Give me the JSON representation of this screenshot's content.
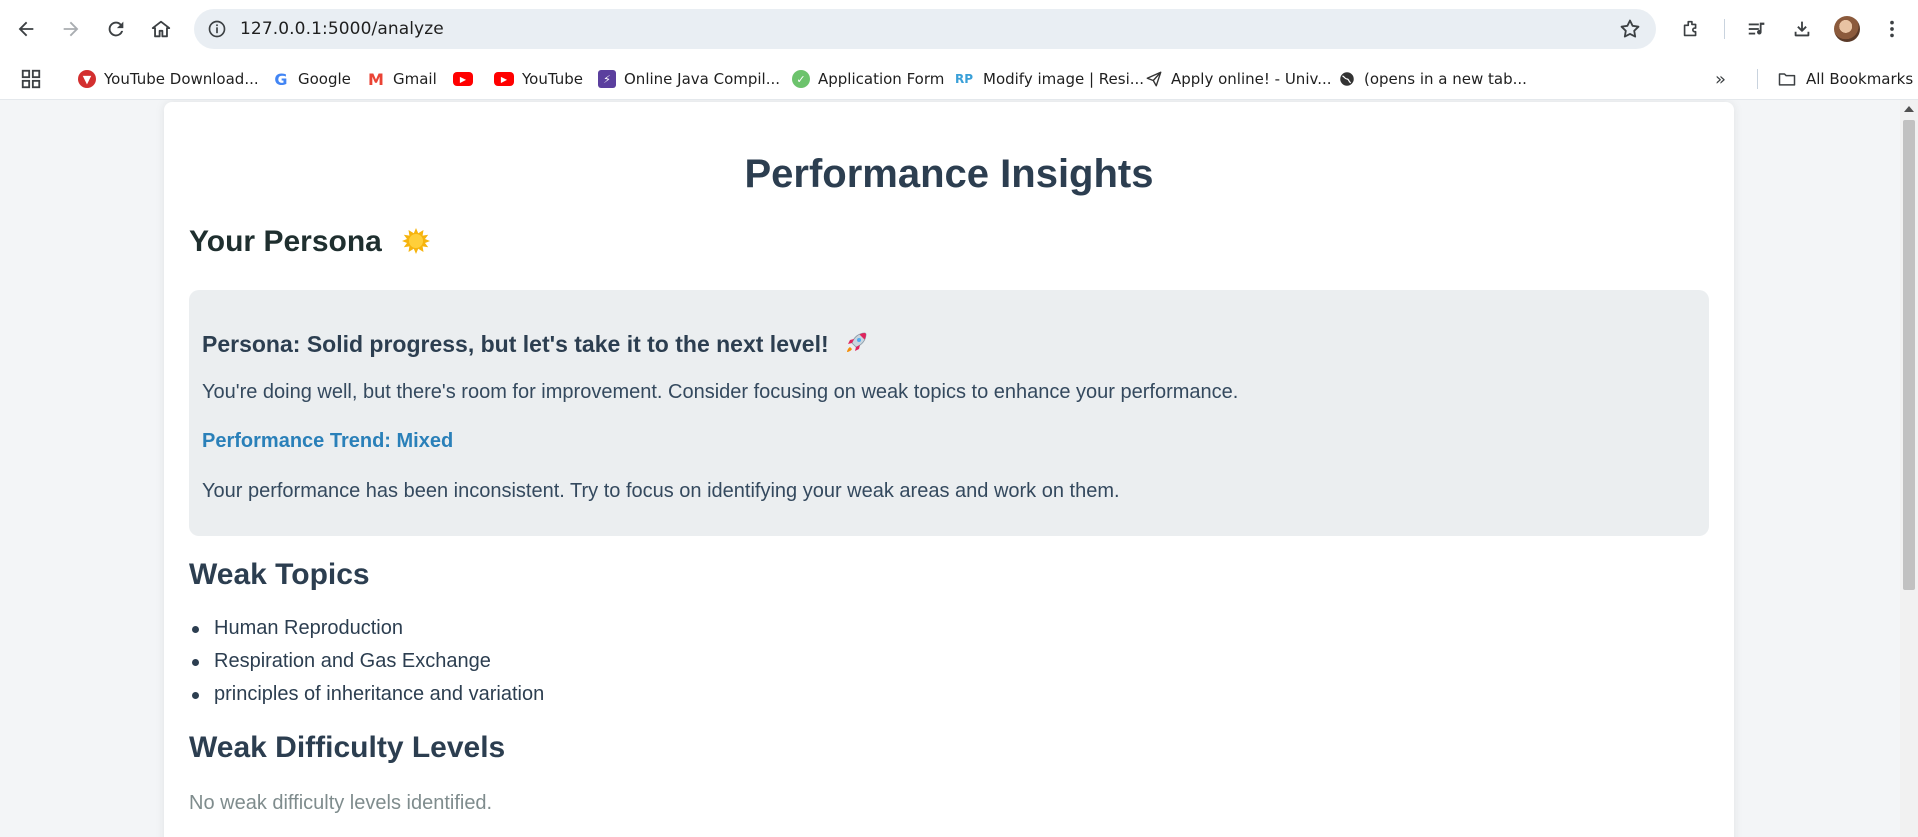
{
  "browser": {
    "url": "127.0.0.1:5000/analyze",
    "bookmarks": [
      {
        "label": "YouTube Download...",
        "icon": "youtube-downloader-icon",
        "color": "#d32f2f"
      },
      {
        "label": "Google",
        "icon": "google-icon",
        "color": "#4285f4"
      },
      {
        "label": "Gmail",
        "icon": "gmail-icon",
        "color": "#ea4335"
      },
      {
        "label": "",
        "icon": "youtube-icon",
        "color": "#ff0000"
      },
      {
        "label": "YouTube",
        "icon": "youtube-icon",
        "color": "#ff0000"
      },
      {
        "label": "Online Java Compil...",
        "icon": "java-compiler-icon",
        "color": "#5b3f9e"
      },
      {
        "label": "Application Form",
        "icon": "check-circle-icon",
        "color": "#6cc36c"
      },
      {
        "label": "Modify image | Resi...",
        "icon": "rp-icon",
        "color": "#3aa0d8"
      },
      {
        "label": "Apply online! - Univ...",
        "icon": "paper-plane-icon",
        "color": "#333333"
      },
      {
        "label": "(opens in a new tab...",
        "icon": "globe-icon",
        "color": "#333333"
      }
    ],
    "all_bookmarks": "All Bookmarks"
  },
  "page": {
    "title": "Performance Insights",
    "persona_heading": "Your Persona",
    "persona_title": "Persona: Solid progress, but let's take it to the next level!",
    "persona_text": "You're doing well, but there's room for improvement. Consider focusing on weak topics to enhance your performance.",
    "trend": "Performance Trend: Mixed",
    "trend_text": "Your performance has been inconsistent. Try to focus on identifying your weak areas and work on them.",
    "weak_topics_heading": "Weak Topics",
    "weak_topics": [
      "Human Reproduction",
      "Respiration and Gas Exchange",
      "principles of inheritance and variation"
    ],
    "weak_difficulty_heading": "Weak Difficulty Levels",
    "weak_difficulty_text": "No weak difficulty levels identified."
  },
  "colors": {
    "heading": "#2c3e50",
    "trend": "#2a80b9",
    "muted": "#7f8c8d",
    "persona_bg": "#ebeef0"
  }
}
